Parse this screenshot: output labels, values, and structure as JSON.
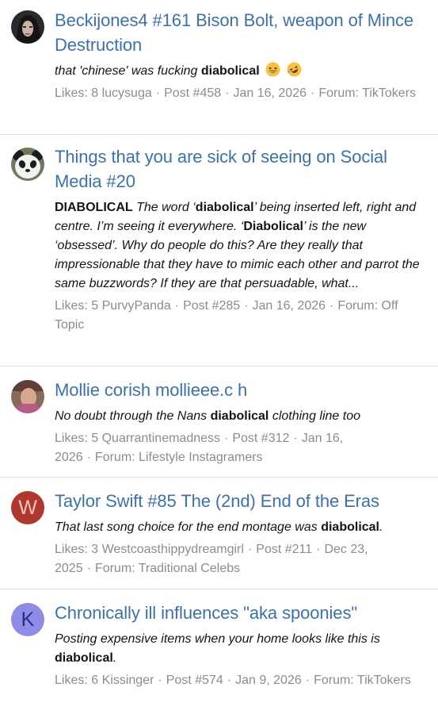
{
  "results": [
    {
      "avatar": {
        "type": "photo",
        "icon": "dark-hair-portrait"
      },
      "title": "Beckijones4 #161 Bison Bolt, weapon of Mince Destruction",
      "snippet": {
        "parts": [
          {
            "text": "that 'chinese' was fucking ",
            "bold": false
          },
          {
            "text": "diabolical",
            "bold": true
          }
        ],
        "emojis": [
          "laughing-face-emoji",
          "rolling-on-floor-laughing-emoji"
        ]
      },
      "meta": {
        "likes": "Likes: 8",
        "user": "lucysuga",
        "post": "Post #458",
        "date": "Jan 16, 2026",
        "forum_prefix": "Forum:",
        "forum": "TikTokers"
      }
    },
    {
      "avatar": {
        "type": "photo",
        "icon": "panda-avatar"
      },
      "title": "Things that you are sick of seeing on Social Media #20",
      "snippet": {
        "parts": [
          {
            "text": "DIABOLICAL",
            "bold": true
          },
          {
            "text": " The word ‘",
            "bold": false
          },
          {
            "text": "diabolical",
            "bold": true
          },
          {
            "text": "’ being inserted left, right and centre. I’m seeing it everywhere. ‘",
            "bold": false
          },
          {
            "text": "Diabolical",
            "bold": true
          },
          {
            "text": "’ is the new ‘obsessed’. Why do people do this? Are they really that impressionable that they have to mimic each other and parrot the same buzzwords? If they are that persuadable, what...",
            "bold": false
          }
        ],
        "emojis": []
      },
      "meta": {
        "likes": "Likes: 5",
        "user": "PurvyPanda",
        "post": "Post #285",
        "date": "Jan 16, 2026",
        "forum_prefix": "Forum:",
        "forum": "Off Topic"
      }
    },
    {
      "avatar": {
        "type": "photo",
        "icon": "person-photo-avatar"
      },
      "title": "Mollie corish mollieee.c h",
      "snippet": {
        "parts": [
          {
            "text": "No doubt through the Nans ",
            "bold": false
          },
          {
            "text": "diabolical",
            "bold": true
          },
          {
            "text": " clothing line too",
            "bold": false
          }
        ],
        "emojis": []
      },
      "meta": {
        "likes": "Likes: 5",
        "user": "Quarrantinemadness",
        "post": "Post #312",
        "date": "Jan 16, 2026",
        "forum_prefix": "Forum:",
        "forum": "Lifestyle Instagramers"
      }
    },
    {
      "avatar": {
        "type": "letter",
        "letter": "W",
        "bg": "#b0372d",
        "fg": "#f2c7bf"
      },
      "title": "Taylor Swift #85 The (2nd) End of the Eras",
      "snippet": {
        "parts": [
          {
            "text": "That last song choice for the end montage was ",
            "bold": false
          },
          {
            "text": "diabolical",
            "bold": true
          },
          {
            "text": ".",
            "bold": false
          }
        ],
        "emojis": []
      },
      "meta": {
        "likes": "Likes: 3",
        "user": "Westcoasthippydreamgirl",
        "post": "Post #211",
        "date": "Dec 23, 2025",
        "forum_prefix": "Forum:",
        "forum": "Traditional Celebs"
      }
    },
    {
      "avatar": {
        "type": "letter",
        "letter": "K",
        "bg": "#8f8ce8",
        "fg": "#2e2c7a"
      },
      "title": "Chronically ill influences \"aka spoonies\"",
      "snippet": {
        "parts": [
          {
            "text": "Posting expensive items when your home looks like this is ",
            "bold": false
          },
          {
            "text": "diabolical",
            "bold": true
          },
          {
            "text": ".",
            "bold": false
          }
        ],
        "emojis": []
      },
      "meta": {
        "likes": "Likes: 6",
        "user": "Kissinger",
        "post": "Post #574",
        "date": "Jan 9, 2026",
        "forum_prefix": "Forum:",
        "forum": "TikTokers"
      }
    }
  ],
  "colors": {
    "link": "#3b72aa",
    "meta": "#8c8c8c",
    "divider": "#dcdfe3"
  }
}
